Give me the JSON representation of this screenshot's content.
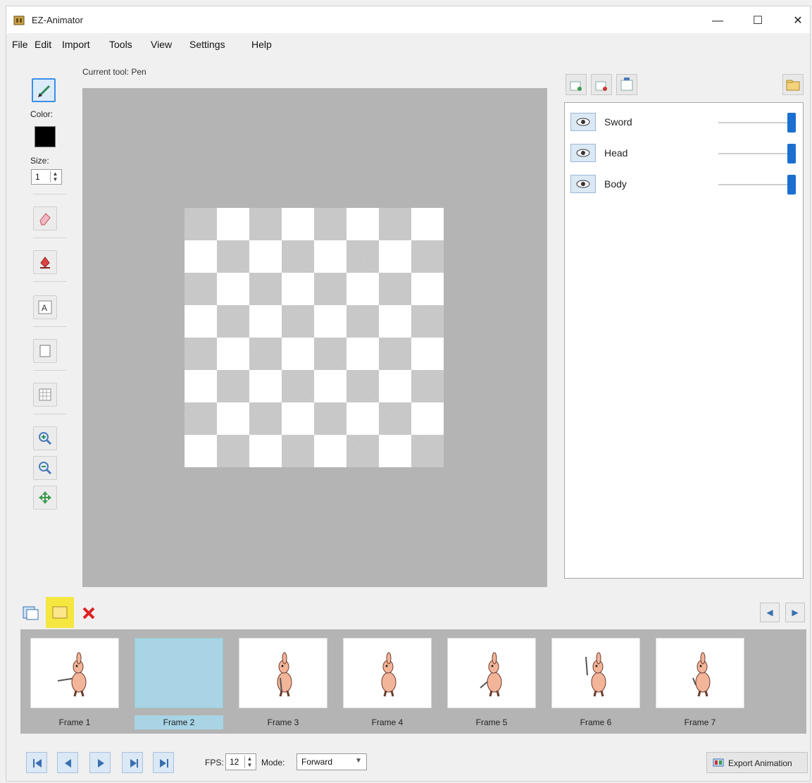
{
  "app": {
    "title": "EZ-Animator"
  },
  "window_controls": {
    "minimize": "—",
    "maximize": "☐",
    "close": "✕"
  },
  "menu": [
    "File",
    "Edit",
    "Import",
    "Tools",
    "View",
    "Settings",
    "Help"
  ],
  "toolbar": {
    "color_label": "Color:",
    "color_value": "#000000",
    "size_label": "Size:",
    "size_value": "1",
    "tools": [
      "pen",
      "eraser",
      "fill",
      "text",
      "rectangle",
      "grid",
      "zoom-in",
      "zoom-out",
      "move"
    ]
  },
  "canvas": {
    "current_tool": "Current tool: Pen"
  },
  "layers": {
    "items": [
      {
        "name": "Sword",
        "opacity": 1.0
      },
      {
        "name": "Head",
        "opacity": 1.0
      },
      {
        "name": "Body",
        "opacity": 1.0
      }
    ]
  },
  "frames": {
    "selected": "Frame 2",
    "items": [
      {
        "label": "Frame 1"
      },
      {
        "label": "Frame 2"
      },
      {
        "label": "Frame 3"
      },
      {
        "label": "Frame 4"
      },
      {
        "label": "Frame 5"
      },
      {
        "label": "Frame 6"
      },
      {
        "label": "Frame 7"
      }
    ]
  },
  "playback": {
    "fps_label": "FPS:",
    "fps_value": "12",
    "mode_label": "Mode:",
    "mode_value": "Forward",
    "export_label": "Export Animation"
  }
}
